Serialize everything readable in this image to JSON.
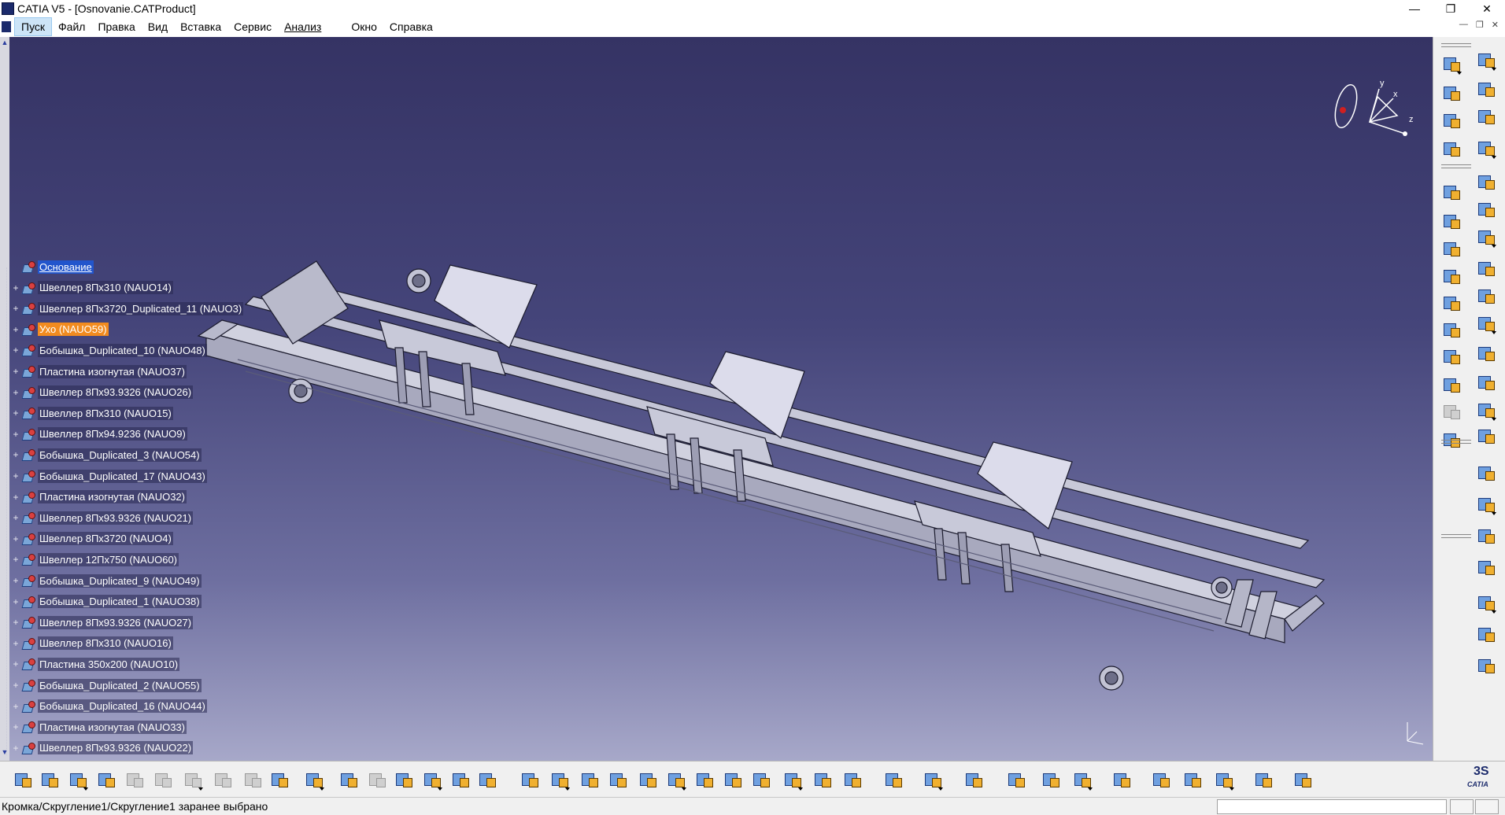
{
  "window": {
    "title": "CATIA V5 - [Osnovanie.CATProduct]",
    "minimize": "—",
    "maximize": "❐",
    "close": "✕"
  },
  "menu": {
    "items": [
      "Пуск",
      "Файл",
      "Правка",
      "Вид",
      "Вставка",
      "Сервис",
      "Анализ",
      "Окно",
      "Справка"
    ]
  },
  "compass": {
    "x": "x",
    "y": "y",
    "z": "z"
  },
  "tree": {
    "root": "Основание",
    "items": [
      {
        "label": "Швеллер 8Пх310 (NAUO14)"
      },
      {
        "label": "Швеллер 8Пх3720_Duplicated_11 (NAUO3)"
      },
      {
        "label": "Ухо (NAUO59)",
        "selected": true
      },
      {
        "label": "Бобышка_Duplicated_10 (NAUO48)"
      },
      {
        "label": "Пластина изогнутая (NAUO37)"
      },
      {
        "label": "Швеллер 8Пх93.9326 (NAUO26)"
      },
      {
        "label": "Швеллер 8Пх310 (NAUO15)"
      },
      {
        "label": "Швеллер 8Пх94.9236 (NAUO9)"
      },
      {
        "label": "Бобышка_Duplicated_3 (NAUO54)"
      },
      {
        "label": "Бобышка_Duplicated_17 (NAUO43)"
      },
      {
        "label": "Пластина изогнутая (NAUO32)"
      },
      {
        "label": "Швеллер 8Пх93.9326 (NAUO21)"
      },
      {
        "label": "Швеллер 8Пх3720 (NAUO4)"
      },
      {
        "label": "Швеллер 12Пх750 (NAUO60)"
      },
      {
        "label": "Бобышка_Duplicated_9 (NAUO49)"
      },
      {
        "label": "Бобышка_Duplicated_1 (NAUO38)"
      },
      {
        "label": "Швеллер 8Пх93.9326 (NAUO27)"
      },
      {
        "label": "Швеллер 8Пх310 (NAUO16)"
      },
      {
        "label": "Пластина 350х200 (NAUO10)"
      },
      {
        "label": "Бобышка_Duplicated_2 (NAUO55)"
      },
      {
        "label": "Бобышка_Duplicated_16 (NAUO44)"
      },
      {
        "label": "Пластина изогнутая (NAUO33)"
      },
      {
        "label": "Швеллер 8Пх93.9326 (NAUO22)"
      }
    ]
  },
  "status": {
    "message": "Кромка/Скругление1/Скругление1 заранее выбрано"
  },
  "brand": {
    "ds": "3S",
    "name": "CATIA"
  },
  "icons": {
    "right_col1": [
      "product-icon",
      "component-icon",
      "tree-icon",
      "bom-icon",
      "constraint-icon",
      "manipulate-icon",
      "snap-icon",
      "fix-icon",
      "offset-icon",
      "clash-icon",
      "measure-icon",
      "section-icon",
      "sectioning-icon",
      "annotation-icon"
    ],
    "right_col2": [
      "gear-icon",
      "select-icon",
      "catalog-icon",
      "move-icon",
      "explode-icon",
      "scene-icon",
      "save-icon",
      "dimension-icon",
      "text-icon",
      "table-icon",
      "balloon-icon",
      "view-icon",
      "weld-icon",
      "spot-icon",
      "capture-icon",
      "update-icon",
      "hide-icon",
      "reorder-icon",
      "assembly-icon",
      "paste-icon",
      "replace-icon"
    ],
    "bottom": [
      "new-icon",
      "open-icon",
      "save-icon",
      "print-icon",
      "cut-icon",
      "copy-icon",
      "paste-icon",
      "undo-icon",
      "redo-icon",
      "help-icon",
      "formula-icon",
      "comment-icon",
      "light-icon",
      "table-icon",
      "graph-icon",
      "lock-icon",
      "filter-icon",
      "fly-icon",
      "fit-icon",
      "pan-icon",
      "rotate-icon",
      "zoom-in-icon",
      "zoom-out-icon",
      "normal-view-icon",
      "multi-view-icon",
      "iso-view-icon",
      "shade-icon",
      "material-icon",
      "render-icon",
      "measure-icon",
      "camera-icon",
      "scene-icon",
      "swap-icon",
      "catalog-icon",
      "weight-icon",
      "update-icon",
      "layer-icon",
      "apply-icon",
      "capture-icon",
      "texture-icon",
      "grid-icon"
    ]
  }
}
